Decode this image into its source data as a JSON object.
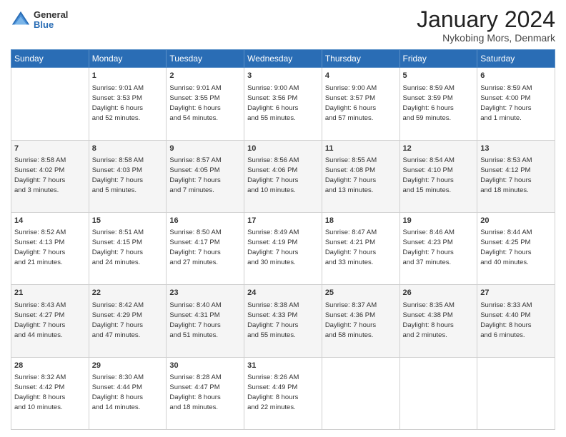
{
  "header": {
    "logo": {
      "general": "General",
      "blue": "Blue"
    },
    "title": "January 2024",
    "location": "Nykobing Mors, Denmark"
  },
  "days_of_week": [
    "Sunday",
    "Monday",
    "Tuesday",
    "Wednesday",
    "Thursday",
    "Friday",
    "Saturday"
  ],
  "weeks": [
    [
      {
        "day": "",
        "info": ""
      },
      {
        "day": "1",
        "info": "Sunrise: 9:01 AM\nSunset: 3:53 PM\nDaylight: 6 hours\nand 52 minutes."
      },
      {
        "day": "2",
        "info": "Sunrise: 9:01 AM\nSunset: 3:55 PM\nDaylight: 6 hours\nand 54 minutes."
      },
      {
        "day": "3",
        "info": "Sunrise: 9:00 AM\nSunset: 3:56 PM\nDaylight: 6 hours\nand 55 minutes."
      },
      {
        "day": "4",
        "info": "Sunrise: 9:00 AM\nSunset: 3:57 PM\nDaylight: 6 hours\nand 57 minutes."
      },
      {
        "day": "5",
        "info": "Sunrise: 8:59 AM\nSunset: 3:59 PM\nDaylight: 6 hours\nand 59 minutes."
      },
      {
        "day": "6",
        "info": "Sunrise: 8:59 AM\nSunset: 4:00 PM\nDaylight: 7 hours\nand 1 minute."
      }
    ],
    [
      {
        "day": "7",
        "info": "Sunrise: 8:58 AM\nSunset: 4:02 PM\nDaylight: 7 hours\nand 3 minutes."
      },
      {
        "day": "8",
        "info": "Sunrise: 8:58 AM\nSunset: 4:03 PM\nDaylight: 7 hours\nand 5 minutes."
      },
      {
        "day": "9",
        "info": "Sunrise: 8:57 AM\nSunset: 4:05 PM\nDaylight: 7 hours\nand 7 minutes."
      },
      {
        "day": "10",
        "info": "Sunrise: 8:56 AM\nSunset: 4:06 PM\nDaylight: 7 hours\nand 10 minutes."
      },
      {
        "day": "11",
        "info": "Sunrise: 8:55 AM\nSunset: 4:08 PM\nDaylight: 7 hours\nand 13 minutes."
      },
      {
        "day": "12",
        "info": "Sunrise: 8:54 AM\nSunset: 4:10 PM\nDaylight: 7 hours\nand 15 minutes."
      },
      {
        "day": "13",
        "info": "Sunrise: 8:53 AM\nSunset: 4:12 PM\nDaylight: 7 hours\nand 18 minutes."
      }
    ],
    [
      {
        "day": "14",
        "info": "Sunrise: 8:52 AM\nSunset: 4:13 PM\nDaylight: 7 hours\nand 21 minutes."
      },
      {
        "day": "15",
        "info": "Sunrise: 8:51 AM\nSunset: 4:15 PM\nDaylight: 7 hours\nand 24 minutes."
      },
      {
        "day": "16",
        "info": "Sunrise: 8:50 AM\nSunset: 4:17 PM\nDaylight: 7 hours\nand 27 minutes."
      },
      {
        "day": "17",
        "info": "Sunrise: 8:49 AM\nSunset: 4:19 PM\nDaylight: 7 hours\nand 30 minutes."
      },
      {
        "day": "18",
        "info": "Sunrise: 8:47 AM\nSunset: 4:21 PM\nDaylight: 7 hours\nand 33 minutes."
      },
      {
        "day": "19",
        "info": "Sunrise: 8:46 AM\nSunset: 4:23 PM\nDaylight: 7 hours\nand 37 minutes."
      },
      {
        "day": "20",
        "info": "Sunrise: 8:44 AM\nSunset: 4:25 PM\nDaylight: 7 hours\nand 40 minutes."
      }
    ],
    [
      {
        "day": "21",
        "info": "Sunrise: 8:43 AM\nSunset: 4:27 PM\nDaylight: 7 hours\nand 44 minutes."
      },
      {
        "day": "22",
        "info": "Sunrise: 8:42 AM\nSunset: 4:29 PM\nDaylight: 7 hours\nand 47 minutes."
      },
      {
        "day": "23",
        "info": "Sunrise: 8:40 AM\nSunset: 4:31 PM\nDaylight: 7 hours\nand 51 minutes."
      },
      {
        "day": "24",
        "info": "Sunrise: 8:38 AM\nSunset: 4:33 PM\nDaylight: 7 hours\nand 55 minutes."
      },
      {
        "day": "25",
        "info": "Sunrise: 8:37 AM\nSunset: 4:36 PM\nDaylight: 7 hours\nand 58 minutes."
      },
      {
        "day": "26",
        "info": "Sunrise: 8:35 AM\nSunset: 4:38 PM\nDaylight: 8 hours\nand 2 minutes."
      },
      {
        "day": "27",
        "info": "Sunrise: 8:33 AM\nSunset: 4:40 PM\nDaylight: 8 hours\nand 6 minutes."
      }
    ],
    [
      {
        "day": "28",
        "info": "Sunrise: 8:32 AM\nSunset: 4:42 PM\nDaylight: 8 hours\nand 10 minutes."
      },
      {
        "day": "29",
        "info": "Sunrise: 8:30 AM\nSunset: 4:44 PM\nDaylight: 8 hours\nand 14 minutes."
      },
      {
        "day": "30",
        "info": "Sunrise: 8:28 AM\nSunset: 4:47 PM\nDaylight: 8 hours\nand 18 minutes."
      },
      {
        "day": "31",
        "info": "Sunrise: 8:26 AM\nSunset: 4:49 PM\nDaylight: 8 hours\nand 22 minutes."
      },
      {
        "day": "",
        "info": ""
      },
      {
        "day": "",
        "info": ""
      },
      {
        "day": "",
        "info": ""
      }
    ]
  ]
}
